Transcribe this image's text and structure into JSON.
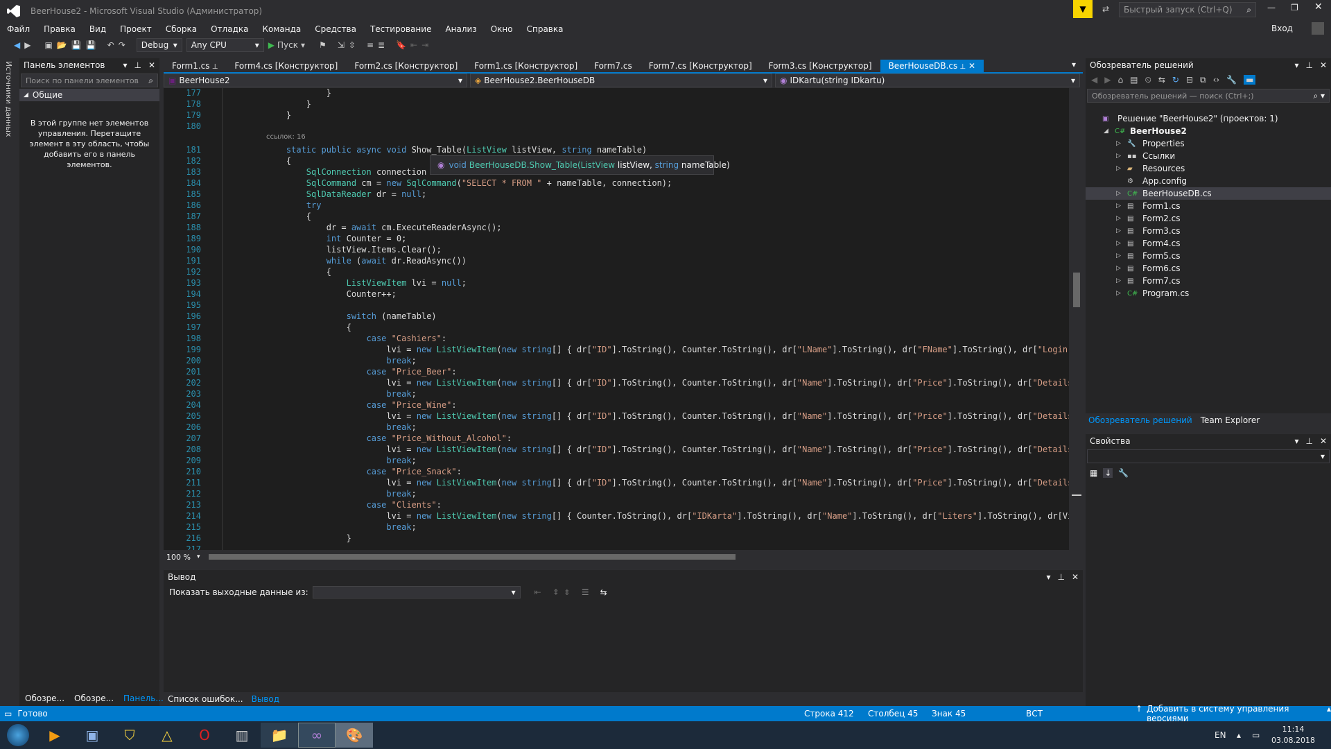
{
  "window": {
    "title": "BeerHouse2 - Microsoft Visual Studio (Администратор)",
    "quick_launch_placeholder": "Быстрый запуск (Ctrl+Q)",
    "sign_in": "Вход"
  },
  "menu": [
    "Файл",
    "Правка",
    "Вид",
    "Проект",
    "Сборка",
    "Отладка",
    "Команда",
    "Средства",
    "Тестирование",
    "Анализ",
    "Окно",
    "Справка"
  ],
  "toolbar": {
    "config": "Debug",
    "platform": "Any CPU",
    "run_label": "Пуск"
  },
  "left_strip": {
    "label": "Источники данных"
  },
  "toolbox": {
    "title": "Панель элементов",
    "search_placeholder": "Поиск по панели элементов",
    "group": "Общие",
    "empty_text": "В этой группе нет элементов управления. Перетащите элемент в эту область, чтобы добавить его в панель элементов.",
    "bottom_tabs": [
      "Обозре...",
      "Обозре...",
      "Панель..."
    ]
  },
  "tabs": [
    "Form1.cs",
    "Form4.cs [Конструктор]",
    "Form2.cs [Конструктор]",
    "Form1.cs [Конструктор]",
    "Form7.cs",
    "Form7.cs [Конструктор]",
    "Form3.cs [Конструктор]",
    "BeerHouseDB.cs"
  ],
  "navbar": {
    "project": "BeerHouse2",
    "class": "BeerHouse2.BeerHouseDB",
    "member": "IDKartu(string IDkartu)"
  },
  "editor": {
    "refs_label": "ссылок: 16",
    "tooltip": {
      "ret": "void",
      "cls": "BeerHouseDB.Show_Table(",
      "t1": "ListView",
      "p1": " listView, ",
      "t2": "string",
      "p2": " nameTable)"
    },
    "lines": [
      {
        "n": "177",
        "code": "            }"
      },
      {
        "n": "178",
        "code": "        }"
      },
      {
        "n": "179",
        "code": "    }"
      },
      {
        "n": "180",
        "code": ""
      },
      {
        "n": "181",
        "code": "    static public async void Show_Table(ListView listView, string nameTable)"
      },
      {
        "n": "182",
        "code": "    {"
      },
      {
        "n": "183",
        "code": "        SqlConnection connection = Cor"
      },
      {
        "n": "184",
        "code": "        SqlCommand cm = new SqlCommand(\"SELECT * FROM \" + nameTable, connection);"
      },
      {
        "n": "185",
        "code": "        SqlDataReader dr = null;"
      },
      {
        "n": "186",
        "code": "        try"
      },
      {
        "n": "187",
        "code": "        {"
      },
      {
        "n": "188",
        "code": "            dr = await cm.ExecuteReaderAsync();"
      },
      {
        "n": "189",
        "code": "            int Counter = 0;"
      },
      {
        "n": "190",
        "code": "            listView.Items.Clear();"
      },
      {
        "n": "191",
        "code": "            while (await dr.ReadAsync())"
      },
      {
        "n": "192",
        "code": "            {"
      },
      {
        "n": "193",
        "code": "                ListViewItem lvi = null;"
      },
      {
        "n": "194",
        "code": "                Counter++;"
      },
      {
        "n": "195",
        "code": ""
      },
      {
        "n": "196",
        "code": "                switch (nameTable)"
      },
      {
        "n": "197",
        "code": "                {"
      },
      {
        "n": "198",
        "code": "                    case \"Cashiers\":"
      },
      {
        "n": "199",
        "code": "                        lvi = new ListViewItem(new string[] { dr[\"ID\"].ToString(), Counter.ToString(), dr[\"LName\"].ToString(), dr[\"FName\"].ToString(), dr[\"Login\"].ToStri"
      },
      {
        "n": "200",
        "code": "                        break;"
      },
      {
        "n": "201",
        "code": "                    case \"Price_Beer\":"
      },
      {
        "n": "202",
        "code": "                        lvi = new ListViewItem(new string[] { dr[\"ID\"].ToString(), Counter.ToString(), dr[\"Name\"].ToString(), dr[\"Price\"].ToString(), dr[\"Details\"].ToStri"
      },
      {
        "n": "203",
        "code": "                        break;"
      },
      {
        "n": "204",
        "code": "                    case \"Price_Wine\":"
      },
      {
        "n": "205",
        "code": "                        lvi = new ListViewItem(new string[] { dr[\"ID\"].ToString(), Counter.ToString(), dr[\"Name\"].ToString(), dr[\"Price\"].ToString(), dr[\"Details\"].ToStri"
      },
      {
        "n": "206",
        "code": "                        break;"
      },
      {
        "n": "207",
        "code": "                    case \"Price_Without_Alcohol\":"
      },
      {
        "n": "208",
        "code": "                        lvi = new ListViewItem(new string[] { dr[\"ID\"].ToString(), Counter.ToString(), dr[\"Name\"].ToString(), dr[\"Price\"].ToString(), dr[\"Details\"].ToStri"
      },
      {
        "n": "209",
        "code": "                        break;"
      },
      {
        "n": "210",
        "code": "                    case \"Price_Snack\":"
      },
      {
        "n": "211",
        "code": "                        lvi = new ListViewItem(new string[] { dr[\"ID\"].ToString(), Counter.ToString(), dr[\"Name\"].ToString(), dr[\"Price\"].ToString(), dr[\"Details\"].ToStri"
      },
      {
        "n": "212",
        "code": "                        break;"
      },
      {
        "n": "213",
        "code": "                    case \"Clients\":"
      },
      {
        "n": "214",
        "code": "                        lvi = new ListViewItem(new string[] { Counter.ToString(), dr[\"IDKarta\"].ToString(), dr[\"Name\"].ToString(), dr[\"Liters\"].ToString(), dr[\"VipTimeAL"
      },
      {
        "n": "215",
        "code": "                        break;"
      },
      {
        "n": "216",
        "code": "                }"
      },
      {
        "n": "217",
        "code": ""
      }
    ],
    "zoom": "100 %"
  },
  "output": {
    "title": "Вывод",
    "show_from": "Показать выходные данные из:",
    "bottom_tabs": [
      "Список ошибок...",
      "Вывод"
    ]
  },
  "solution": {
    "title": "Обозреватель решений",
    "search_placeholder": "Обозреватель решений — поиск (Ctrl+;)",
    "items": [
      {
        "label": "Решение \"BeerHouse2\" (проектов: 1)",
        "level": 0,
        "icon": "solution-icon",
        "expander": ""
      },
      {
        "label": "BeerHouse2",
        "level": 1,
        "icon": "csharp-project-icon",
        "expander": "◢"
      },
      {
        "label": "Properties",
        "level": 2,
        "icon": "wrench-icon",
        "expander": "▷"
      },
      {
        "label": "Ссылки",
        "level": 2,
        "icon": "references-icon",
        "expander": "▷"
      },
      {
        "label": "Resources",
        "level": 2,
        "icon": "folder-icon",
        "expander": "▷"
      },
      {
        "label": "App.config",
        "level": 2,
        "icon": "config-icon",
        "expander": ""
      },
      {
        "label": "BeerHouseDB.cs",
        "level": 2,
        "icon": "csharp-file-icon",
        "expander": "▷"
      },
      {
        "label": "Form1.cs",
        "level": 2,
        "icon": "form-icon",
        "expander": "▷"
      },
      {
        "label": "Form2.cs",
        "level": 2,
        "icon": "form-icon",
        "expander": "▷"
      },
      {
        "label": "Form3.cs",
        "level": 2,
        "icon": "form-icon",
        "expander": "▷"
      },
      {
        "label": "Form4.cs",
        "level": 2,
        "icon": "form-icon",
        "expander": "▷"
      },
      {
        "label": "Form5.cs",
        "level": 2,
        "icon": "form-icon",
        "expander": "▷"
      },
      {
        "label": "Form6.cs",
        "level": 2,
        "icon": "form-icon",
        "expander": "▷"
      },
      {
        "label": "Form7.cs",
        "level": 2,
        "icon": "form-icon",
        "expander": "▷"
      },
      {
        "label": "Program.cs",
        "level": 2,
        "icon": "csharp-file-icon",
        "expander": "▷"
      }
    ],
    "bottom_tabs": [
      "Обозреватель решений",
      "Team Explorer"
    ]
  },
  "properties": {
    "title": "Свойства"
  },
  "status": {
    "ready": "Готово",
    "line": "Строка 412",
    "col": "Столбец 45",
    "char": "Знак 45",
    "mode": "ВСТ",
    "vcs": "Добавить в систему управления версиями"
  },
  "taskbar": {
    "lang": "EN",
    "time": "11:14",
    "date": "03.08.2018"
  },
  "colors": {
    "accent": "#007acc",
    "background": "#2d2d30",
    "editor": "#1e1e1e"
  }
}
